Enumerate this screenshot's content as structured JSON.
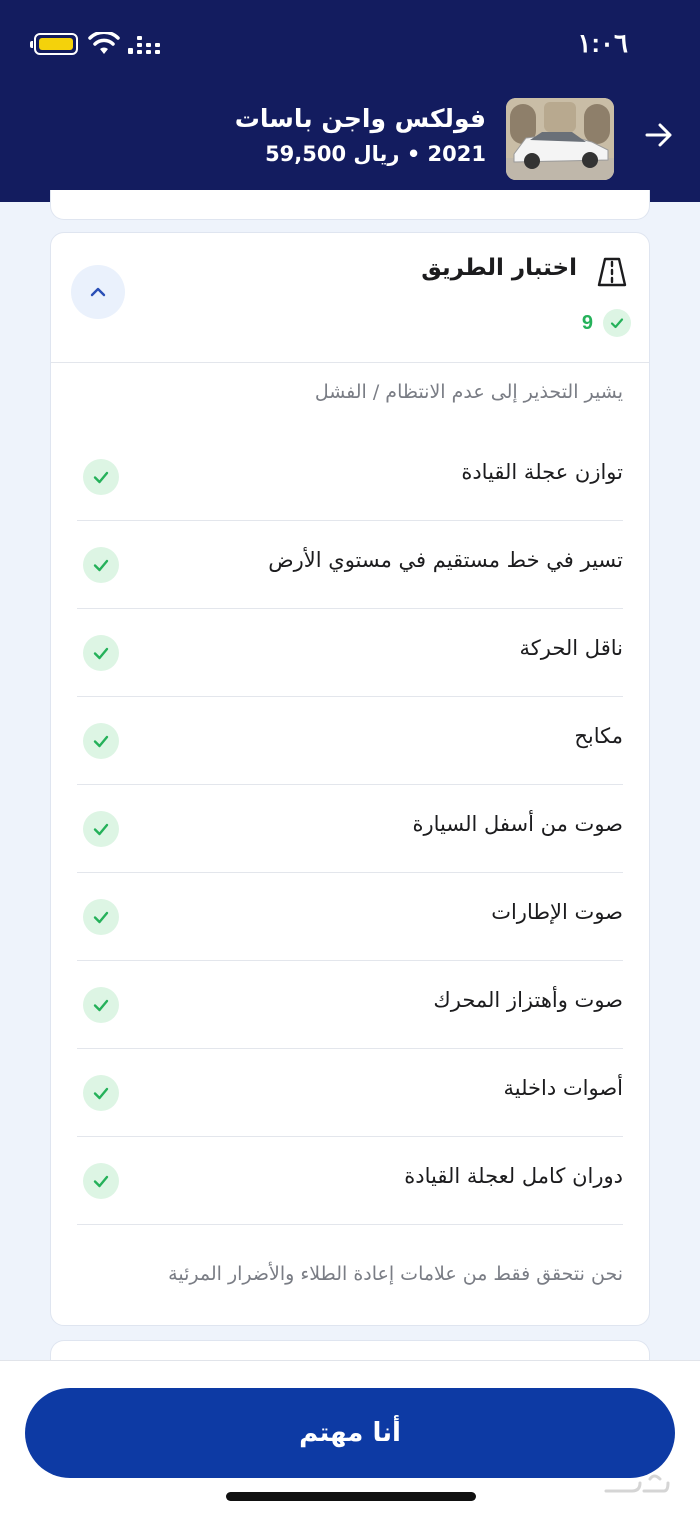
{
  "status_bar": {
    "time": "١:٠٦",
    "battery_color": "#f4d20b"
  },
  "header": {
    "back_icon": "arrow-right-icon",
    "car_title": "فولكس واجن باسات",
    "car_subtitle": "2021 • ريال 59,500",
    "background": "#131c5f"
  },
  "section": {
    "icon": "road-icon",
    "title": "اختبار الطريق",
    "passed_count": "9",
    "collapse_icon": "chevron-up-icon",
    "note_top": "يشير التحذير إلى عدم الانتظام / الفشل",
    "items": [
      {
        "label": "توازن عجلة القيادة",
        "status": "pass"
      },
      {
        "label": "تسير في خط مستقيم في مستوي الأرض",
        "status": "pass"
      },
      {
        "label": "ناقل الحركة",
        "status": "pass"
      },
      {
        "label": "مكابح",
        "status": "pass"
      },
      {
        "label": "صوت من أسفل السيارة",
        "status": "pass"
      },
      {
        "label": "صوت الإطارات",
        "status": "pass"
      },
      {
        "label": "صوت وأهتزاز المحرك",
        "status": "pass"
      },
      {
        "label": "أصوات داخلية",
        "status": "pass"
      },
      {
        "label": "دوران كامل لعجلة القيادة",
        "status": "pass"
      }
    ],
    "note_bottom": "نحن نتحقق فقط من علامات إعادة الطلاء والأضرار المرئية",
    "pass_color": "#25b15a"
  },
  "cta": {
    "label": "أنا مهتم",
    "color": "#0d3aa4"
  },
  "watermark": {
    "text": "حراج"
  }
}
